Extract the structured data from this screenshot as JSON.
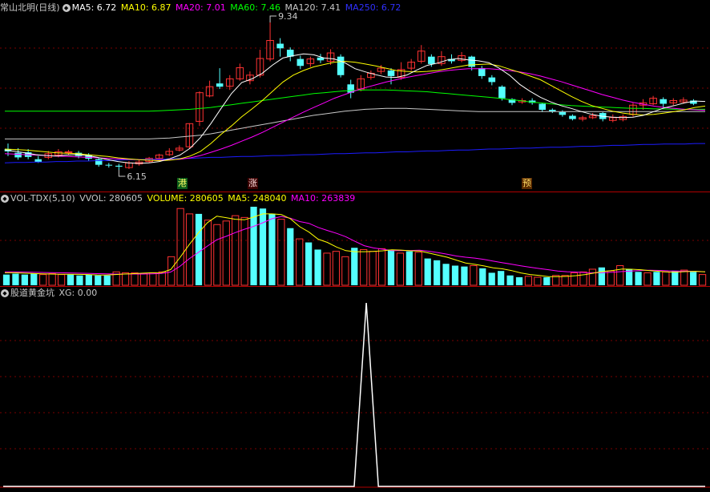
{
  "price_header": {
    "title": "常山北明(日线)",
    "ma5": "MA5: 6.72",
    "ma10": "MA10: 6.87",
    "ma20": "MA20: 7.01",
    "ma60": "MA60: 7.46",
    "ma120": "MA120: 7.41",
    "ma250": "MA250: 6.72"
  },
  "vol_header": {
    "title": "VOL-TDX(5,10)",
    "vvol": "VVOL: 280605",
    "volume": "VOLUME: 280605",
    "ma5": "MA5: 248040",
    "ma10": "MA10: 263839"
  },
  "ind_header": {
    "title": "股道黄金坑",
    "xg": "XG: 0.00"
  },
  "markers": {
    "gang": "港",
    "zhang": "涨",
    "yu": "预"
  },
  "colors": {
    "up": "#ff3232",
    "down": "#54ffff",
    "ma5": "#ffffff",
    "ma10": "#ffff00",
    "ma20": "#ff00ff",
    "ma60": "#00ff00",
    "ma120": "#c8c8c8",
    "ma250": "#1c1cff",
    "grid": "#7a0000"
  },
  "chart_data": [
    {
      "type": "candlestick",
      "title": "常山北明(日线)",
      "price_labels": {
        "high": "9.34",
        "low": "6.15"
      },
      "high": 9.34,
      "low": 6.15,
      "candles": [
        [
          6.6,
          6.55,
          6.72,
          6.45
        ],
        [
          6.52,
          6.42,
          6.62,
          6.37
        ],
        [
          6.53,
          6.43,
          6.6,
          6.38
        ],
        [
          6.38,
          6.32,
          6.45,
          6.3
        ],
        [
          6.42,
          6.5,
          6.56,
          6.38
        ],
        [
          6.47,
          6.54,
          6.6,
          6.42
        ],
        [
          6.54,
          6.54,
          6.58,
          6.48
        ],
        [
          6.52,
          6.45,
          6.56,
          6.4
        ],
        [
          6.48,
          6.39,
          6.51,
          6.35
        ],
        [
          6.38,
          6.26,
          6.4,
          6.22
        ],
        [
          6.26,
          6.25,
          6.3,
          6.2
        ],
        [
          6.24,
          6.22,
          6.28,
          6.15
        ],
        [
          6.2,
          6.3,
          6.34,
          6.17
        ],
        [
          6.28,
          6.32,
          6.36,
          6.24
        ],
        [
          6.33,
          6.4,
          6.43,
          6.3
        ],
        [
          6.4,
          6.47,
          6.5,
          6.37
        ],
        [
          6.48,
          6.55,
          6.62,
          6.45
        ],
        [
          6.58,
          6.62,
          6.68,
          6.55
        ],
        [
          6.65,
          7.15,
          7.16,
          6.6
        ],
        [
          7.2,
          7.82,
          7.85,
          7.1
        ],
        [
          7.75,
          7.95,
          8.08,
          7.72
        ],
        [
          8.02,
          7.95,
          8.35,
          7.9
        ],
        [
          7.96,
          8.12,
          8.2,
          7.88
        ],
        [
          8.12,
          8.36,
          8.45,
          8.08
        ],
        [
          8.08,
          8.2,
          8.28,
          8.0
        ],
        [
          8.2,
          8.56,
          8.75,
          8.15
        ],
        [
          8.55,
          8.95,
          9.34,
          8.5
        ],
        [
          8.88,
          8.78,
          9.0,
          8.6
        ],
        [
          8.75,
          8.6,
          8.8,
          8.5
        ],
        [
          8.55,
          8.4,
          8.62,
          8.33
        ],
        [
          8.45,
          8.55,
          8.6,
          8.38
        ],
        [
          8.58,
          8.52,
          8.66,
          8.46
        ],
        [
          8.5,
          8.68,
          8.76,
          8.42
        ],
        [
          8.6,
          8.2,
          8.65,
          8.15
        ],
        [
          8.0,
          7.82,
          8.1,
          7.7
        ],
        [
          7.9,
          8.12,
          8.2,
          7.85
        ],
        [
          8.15,
          8.24,
          8.3,
          8.1
        ],
        [
          8.28,
          8.35,
          8.42,
          8.22
        ],
        [
          8.3,
          8.18,
          8.35,
          8.0
        ],
        [
          8.15,
          8.32,
          8.48,
          8.1
        ],
        [
          8.35,
          8.48,
          8.55,
          8.3
        ],
        [
          8.5,
          8.72,
          8.85,
          8.45
        ],
        [
          8.6,
          8.44,
          8.65,
          8.38
        ],
        [
          8.45,
          8.6,
          8.72,
          8.4
        ],
        [
          8.55,
          8.5,
          8.65,
          8.45
        ],
        [
          8.52,
          8.62,
          8.7,
          8.48
        ],
        [
          8.6,
          8.38,
          8.62,
          8.3
        ],
        [
          8.35,
          8.18,
          8.4,
          8.12
        ],
        [
          8.15,
          8.05,
          8.2,
          7.98
        ],
        [
          7.95,
          7.7,
          7.98,
          7.65
        ],
        [
          7.68,
          7.6,
          7.7,
          7.55
        ],
        [
          7.62,
          7.65,
          7.7,
          7.58
        ],
        [
          7.65,
          7.6,
          7.7,
          7.56
        ],
        [
          7.58,
          7.45,
          7.6,
          7.4
        ],
        [
          7.45,
          7.42,
          7.48,
          7.38
        ],
        [
          7.4,
          7.34,
          7.44,
          7.3
        ],
        [
          7.32,
          7.25,
          7.35,
          7.22
        ],
        [
          7.25,
          7.28,
          7.32,
          7.2
        ],
        [
          7.28,
          7.32,
          7.38,
          7.25
        ],
        [
          7.38,
          7.25,
          7.4,
          7.2
        ],
        [
          7.22,
          7.28,
          7.35,
          7.18
        ],
        [
          7.24,
          7.3,
          7.35,
          7.2
        ],
        [
          7.35,
          7.55,
          7.6,
          7.3
        ],
        [
          7.55,
          7.6,
          7.68,
          7.45
        ],
        [
          7.58,
          7.7,
          7.75,
          7.55
        ],
        [
          7.68,
          7.58,
          7.72,
          7.5
        ],
        [
          7.6,
          7.65,
          7.7,
          7.55
        ],
        [
          7.62,
          7.66,
          7.72,
          7.58
        ],
        [
          7.65,
          7.58,
          7.68,
          7.55
        ]
      ],
      "ma5": [
        6.58,
        6.55,
        6.52,
        6.48,
        6.46,
        6.45,
        6.47,
        6.48,
        6.46,
        6.42,
        6.37,
        6.33,
        6.3,
        6.29,
        6.3,
        6.33,
        6.39,
        6.47,
        6.62,
        6.85,
        7.15,
        7.48,
        7.8,
        8.04,
        8.12,
        8.24,
        8.42,
        8.57,
        8.62,
        8.66,
        8.64,
        8.57,
        8.55,
        8.47,
        8.34,
        8.27,
        8.21,
        8.16,
        8.15,
        8.2,
        8.31,
        8.41,
        8.46,
        8.53,
        8.56,
        8.53,
        8.51,
        8.47,
        8.35,
        8.2,
        8.0,
        7.85,
        7.72,
        7.62,
        7.54,
        7.48,
        7.41,
        7.35,
        7.31,
        7.29,
        7.28,
        7.29,
        7.33,
        7.41,
        7.49,
        7.54,
        7.6,
        7.64,
        7.63
      ],
      "ma10": [
        6.6,
        6.59,
        6.58,
        6.56,
        6.54,
        6.52,
        6.51,
        6.5,
        6.48,
        6.46,
        6.44,
        6.41,
        6.39,
        6.37,
        6.36,
        6.35,
        6.36,
        6.39,
        6.45,
        6.55,
        6.72,
        6.92,
        7.1,
        7.3,
        7.47,
        7.65,
        7.85,
        8.05,
        8.2,
        8.3,
        8.38,
        8.43,
        8.48,
        8.5,
        8.48,
        8.44,
        8.4,
        8.35,
        8.3,
        8.28,
        8.27,
        8.28,
        8.3,
        8.34,
        8.38,
        8.42,
        8.43,
        8.44,
        8.4,
        8.33,
        8.26,
        8.18,
        8.1,
        7.98,
        7.86,
        7.74,
        7.63,
        7.54,
        7.48,
        7.42,
        7.38,
        7.35,
        7.34,
        7.35,
        7.38,
        7.41,
        7.45,
        7.5,
        7.53
      ],
      "ma20": [
        6.5,
        6.49,
        6.48,
        6.47,
        6.46,
        6.45,
        6.44,
        6.43,
        6.42,
        6.41,
        6.4,
        6.39,
        6.38,
        6.37,
        6.36,
        6.36,
        6.37,
        6.38,
        6.41,
        6.46,
        6.53,
        6.6,
        6.68,
        6.77,
        6.86,
        6.96,
        7.07,
        7.18,
        7.29,
        7.4,
        7.5,
        7.6,
        7.7,
        7.78,
        7.86,
        7.93,
        7.99,
        8.05,
        8.1,
        8.15,
        8.19,
        8.23,
        8.27,
        8.3,
        8.32,
        8.34,
        8.34,
        8.34,
        8.32,
        8.3,
        8.27,
        8.23,
        8.18,
        8.12,
        8.06,
        7.99,
        7.92,
        7.85,
        7.78,
        7.72,
        7.66,
        7.61,
        7.57,
        7.53,
        7.5,
        7.48,
        7.46,
        7.45,
        7.44
      ],
      "ma60": [
        7.42,
        7.42,
        7.42,
        7.42,
        7.42,
        7.42,
        7.42,
        7.42,
        7.42,
        7.42,
        7.42,
        7.42,
        7.42,
        7.42,
        7.42,
        7.43,
        7.44,
        7.45,
        7.46,
        7.48,
        7.5,
        7.53,
        7.56,
        7.59,
        7.62,
        7.65,
        7.68,
        7.71,
        7.74,
        7.77,
        7.8,
        7.82,
        7.84,
        7.86,
        7.87,
        7.88,
        7.88,
        7.88,
        7.87,
        7.86,
        7.85,
        7.84,
        7.82,
        7.8,
        7.78,
        7.76,
        7.74,
        7.72,
        7.7,
        7.67,
        7.65,
        7.62,
        7.6,
        7.58,
        7.56,
        7.54,
        7.53,
        7.52,
        7.51,
        7.5,
        7.49,
        7.48,
        7.48,
        7.47,
        7.47,
        7.46,
        7.46,
        7.46,
        7.46
      ],
      "ma120": [
        6.82,
        6.82,
        6.82,
        6.82,
        6.82,
        6.82,
        6.82,
        6.82,
        6.82,
        6.82,
        6.82,
        6.82,
        6.82,
        6.82,
        6.82,
        6.83,
        6.84,
        6.86,
        6.88,
        6.9,
        6.93,
        6.97,
        7.01,
        7.05,
        7.09,
        7.13,
        7.17,
        7.21,
        7.25,
        7.29,
        7.33,
        7.36,
        7.39,
        7.42,
        7.44,
        7.46,
        7.47,
        7.48,
        7.48,
        7.48,
        7.47,
        7.46,
        7.45,
        7.44,
        7.43,
        7.42,
        7.41,
        7.41,
        7.41,
        7.41,
        7.41,
        7.41,
        7.41,
        7.41,
        7.41,
        7.41,
        7.41,
        7.41,
        7.41,
        7.41,
        7.41,
        7.41,
        7.41,
        7.41,
        7.41,
        7.41,
        7.41,
        7.41,
        7.41
      ],
      "ma250": [
        6.3,
        6.31,
        6.31,
        6.32,
        6.32,
        6.33,
        6.33,
        6.34,
        6.34,
        6.35,
        6.35,
        6.36,
        6.37,
        6.37,
        6.38,
        6.38,
        6.39,
        6.4,
        6.4,
        6.41,
        6.42,
        6.42,
        6.43,
        6.44,
        6.44,
        6.45,
        6.46,
        6.46,
        6.47,
        6.48,
        6.48,
        6.49,
        6.5,
        6.5,
        6.51,
        6.52,
        6.52,
        6.53,
        6.54,
        6.54,
        6.55,
        6.56,
        6.56,
        6.57,
        6.58,
        6.58,
        6.59,
        6.6,
        6.6,
        6.61,
        6.62,
        6.62,
        6.63,
        6.64,
        6.64,
        6.65,
        6.66,
        6.66,
        6.67,
        6.68,
        6.68,
        6.69,
        6.7,
        6.7,
        6.71,
        6.71,
        6.71,
        6.72,
        6.72
      ]
    },
    {
      "type": "bar",
      "title": "VOL-TDX(5,10)",
      "volume": [
        0.6,
        0.65,
        0.6,
        0.65,
        0.6,
        0.65,
        0.6,
        0.6,
        0.55,
        0.6,
        0.55,
        0.55,
        0.75,
        0.7,
        0.7,
        0.65,
        0.7,
        0.75,
        1.6,
        4.3,
        4.0,
        4.0,
        3.65,
        3.4,
        3.6,
        3.9,
        3.8,
        4.4,
        4.3,
        4.0,
        3.7,
        3.2,
        2.6,
        2.4,
        2.0,
        1.8,
        1.9,
        1.6,
        2.1,
        2.0,
        1.9,
        2.05,
        2.0,
        1.8,
        1.9,
        1.85,
        1.5,
        1.4,
        1.2,
        1.1,
        1.05,
        1.1,
        0.95,
        0.7,
        0.8,
        0.55,
        0.45,
        0.5,
        0.45,
        0.45,
        0.55,
        0.55,
        0.7,
        0.75,
        0.9,
        1.0,
        0.8,
        1.1,
        0.9,
        0.75,
        0.7,
        0.75,
        0.75,
        0.8,
        0.85,
        0.75,
        0.6
      ],
      "vol_ma5": [
        0.7,
        0.7,
        0.68,
        0.66,
        0.64,
        0.63,
        0.62,
        0.62,
        0.61,
        0.6,
        0.58,
        0.57,
        0.6,
        0.63,
        0.65,
        0.68,
        0.7,
        0.71,
        0.88,
        1.55,
        2.27,
        2.93,
        3.51,
        3.87,
        3.79,
        3.7,
        3.67,
        3.82,
        4.0,
        4.0,
        3.96,
        3.72,
        3.28,
        2.98,
        2.58,
        2.4,
        2.14,
        1.94,
        1.88,
        1.88,
        1.9,
        1.93,
        1.99,
        1.97,
        1.93,
        1.92,
        1.81,
        1.69,
        1.57,
        1.41,
        1.25,
        1.17,
        1.08,
        0.98,
        0.92,
        0.82,
        0.69,
        0.6,
        0.55,
        0.48,
        0.48,
        0.5,
        0.54,
        0.6,
        0.69,
        0.78,
        0.83,
        0.91,
        0.9,
        0.87,
        0.82,
        0.78,
        0.74,
        0.74,
        0.77,
        0.78,
        0.75
      ],
      "vol_ma10": [
        0.75,
        0.75,
        0.74,
        0.73,
        0.72,
        0.71,
        0.7,
        0.69,
        0.68,
        0.67,
        0.65,
        0.64,
        0.63,
        0.63,
        0.63,
        0.63,
        0.64,
        0.66,
        0.74,
        1.06,
        1.48,
        1.84,
        2.2,
        2.55,
        2.74,
        2.95,
        3.14,
        3.3,
        3.5,
        3.73,
        3.85,
        3.76,
        3.57,
        3.47,
        3.24,
        3.07,
        2.91,
        2.72,
        2.46,
        2.22,
        2.09,
        2.02,
        1.94,
        1.94,
        1.95,
        1.96,
        1.91,
        1.83,
        1.74,
        1.64,
        1.57,
        1.52,
        1.45,
        1.35,
        1.26,
        1.18,
        1.09,
        1.01,
        0.94,
        0.87,
        0.8,
        0.76,
        0.74,
        0.71,
        0.7,
        0.71,
        0.73,
        0.77,
        0.8,
        0.83,
        0.84,
        0.83,
        0.81,
        0.8,
        0.79,
        0.78,
        0.76
      ]
    },
    {
      "type": "line",
      "title": "股道黄金坑",
      "xg": [
        0,
        0,
        0,
        0,
        0,
        0,
        0,
        0,
        0,
        0,
        0,
        0,
        0,
        0,
        0,
        0,
        0,
        0,
        0,
        0,
        0,
        0,
        0,
        0,
        0,
        0,
        0,
        0,
        0,
        0,
        1,
        0,
        0,
        0,
        0,
        0,
        0,
        0,
        0,
        0,
        0,
        0,
        0,
        0,
        0,
        0,
        0,
        0,
        0,
        0,
        0,
        0,
        0,
        0,
        0,
        0,
        0,
        0,
        0
      ],
      "xg_ylim": [
        0,
        1
      ]
    }
  ]
}
